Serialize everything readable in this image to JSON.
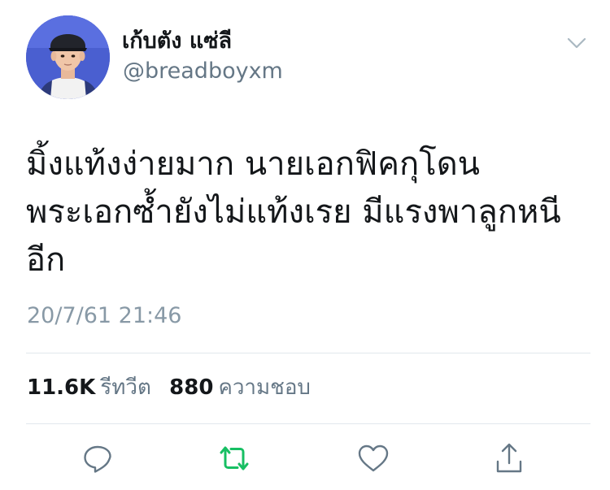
{
  "author": {
    "display_name": "เก้บตัง แซ่ลี",
    "handle": "@breadboyxm",
    "avatar_icon": "avatar-photo"
  },
  "tweet": {
    "lines": [
      "มิ้งแท้งง่ายมาก นายเอกฟิคกุโดน",
      "พระเอกซ้ำยังไม่แท้งเรย มีแรงพาลูกหนี",
      "อีก"
    ],
    "timestamp": "20/7/61 21:46"
  },
  "stats": {
    "retweets_count": "11.6K",
    "retweets_label": "รีทวีต",
    "likes_count": "880",
    "likes_label": "ความชอบ"
  },
  "actions": {
    "reply_icon": "reply-icon",
    "retweet_icon": "retweet-icon",
    "like_icon": "heart-icon",
    "share_icon": "share-icon"
  },
  "colors": {
    "text": "#14171a",
    "secondary": "#657786",
    "timestamp": "#8899a6",
    "retweet_active": "#17bf63",
    "icon": "#657786",
    "divider": "#e1e8ed"
  }
}
